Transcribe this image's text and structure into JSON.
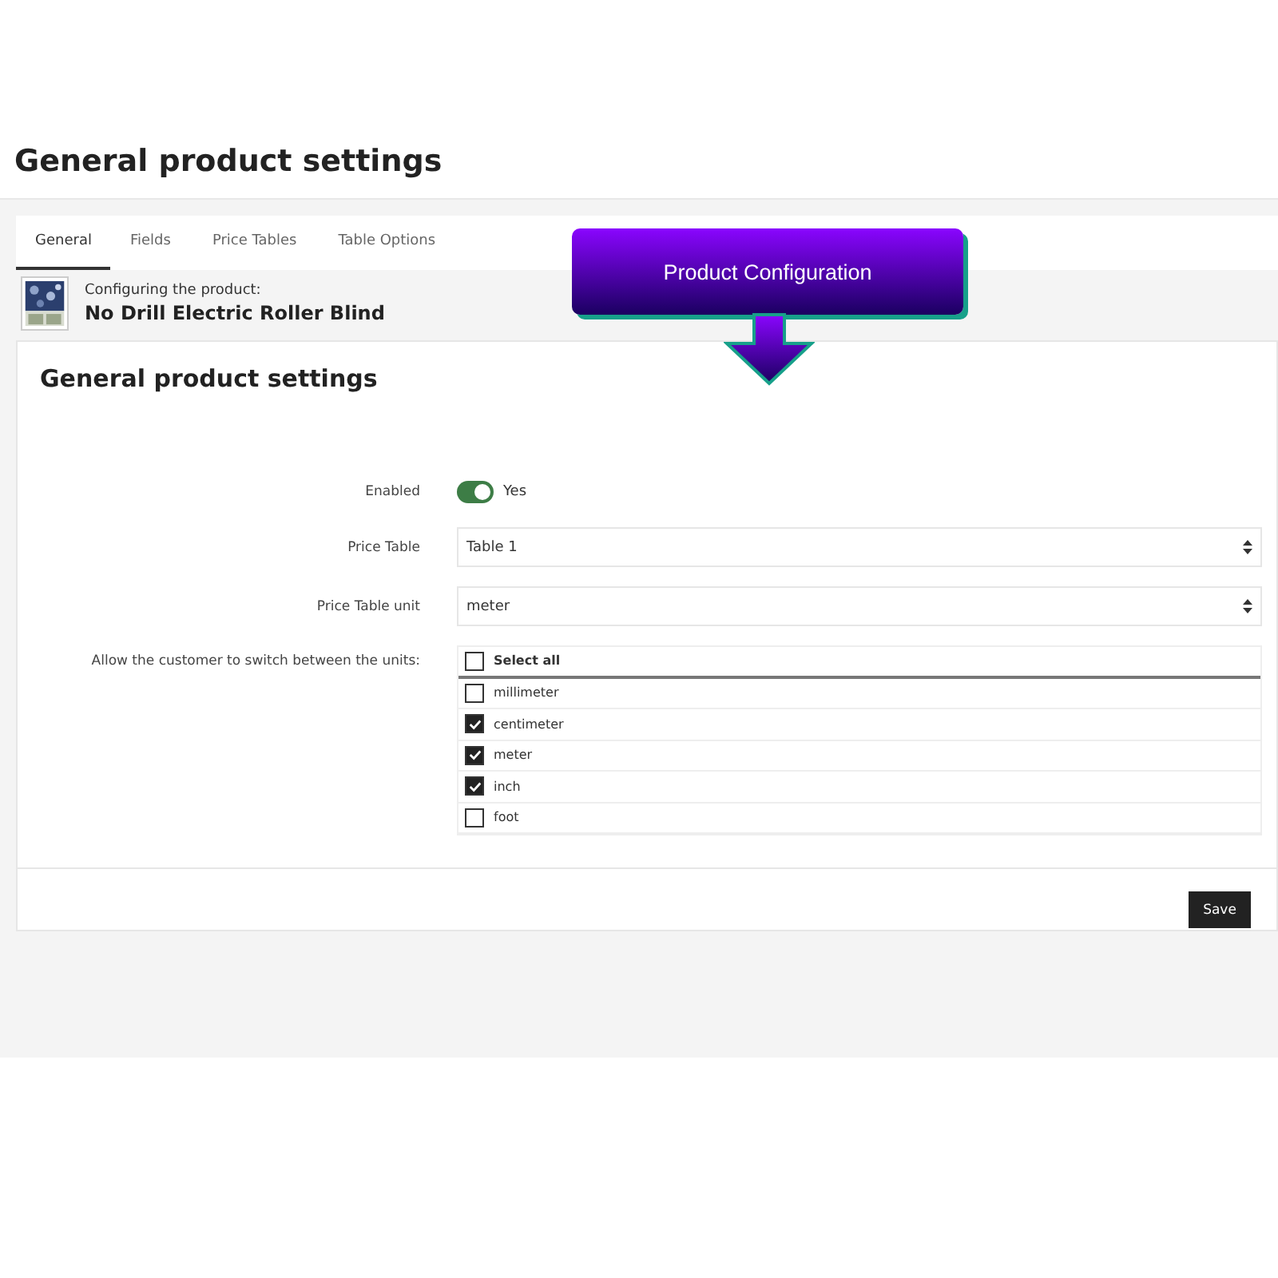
{
  "page_title": "General product settings",
  "tabs": [
    {
      "label": "General",
      "selected": true
    },
    {
      "label": "Fields",
      "selected": false
    },
    {
      "label": "Price Tables",
      "selected": false
    },
    {
      "label": "Table Options",
      "selected": false
    }
  ],
  "product": {
    "caption": "Configuring the product:",
    "name": "No Drill Electric Roller Blind"
  },
  "callout": {
    "label": "Product Configuration"
  },
  "card": {
    "title": "General product settings",
    "enabled": {
      "label": "Enabled",
      "on": true,
      "value": "Yes"
    },
    "price_table": {
      "label": "Price Table",
      "value": "Table 1"
    },
    "price_table_unit": {
      "label": "Price Table unit",
      "value": "meter"
    },
    "units": {
      "label": "Allow the customer to switch between the units:",
      "select_all": {
        "label": "Select all",
        "checked": false
      },
      "options": [
        {
          "label": "millimeter",
          "checked": false
        },
        {
          "label": "centimeter",
          "checked": true
        },
        {
          "label": "meter",
          "checked": true
        },
        {
          "label": "inch",
          "checked": true
        },
        {
          "label": "foot",
          "checked": false
        }
      ]
    },
    "save": "Save"
  }
}
